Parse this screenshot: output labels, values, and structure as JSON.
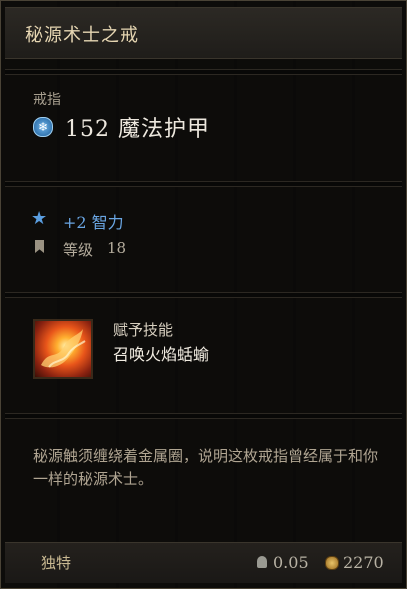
{
  "item": {
    "title": "秘源术士之戒",
    "category": "戒指",
    "armor_value": "152 魔法护甲",
    "bonus": "+2 智力",
    "level_label": "等级",
    "level_value": "18",
    "skill_heading": "赋予技能",
    "skill_name": "召唤火焰蛞蝓",
    "flavor_text": "秘源触须缠绕着金属圈，说明这枚戒指曾经属于和你一样的秘源术士。",
    "rarity": "独特",
    "weight": "0.05",
    "price": "2270"
  },
  "icons": {
    "armor": "magic-armor-snowflake-icon",
    "bonus": "star-icon",
    "level": "bookmark-icon",
    "skill": "fire-slug-skill-icon",
    "weight": "weight-icon",
    "price": "gold-coin-icon"
  },
  "colors": {
    "title": "#e6d6b2",
    "bonus": "#6aa6e3",
    "magic_armor": "#3a8ad0",
    "rarity": "#c9b992"
  }
}
